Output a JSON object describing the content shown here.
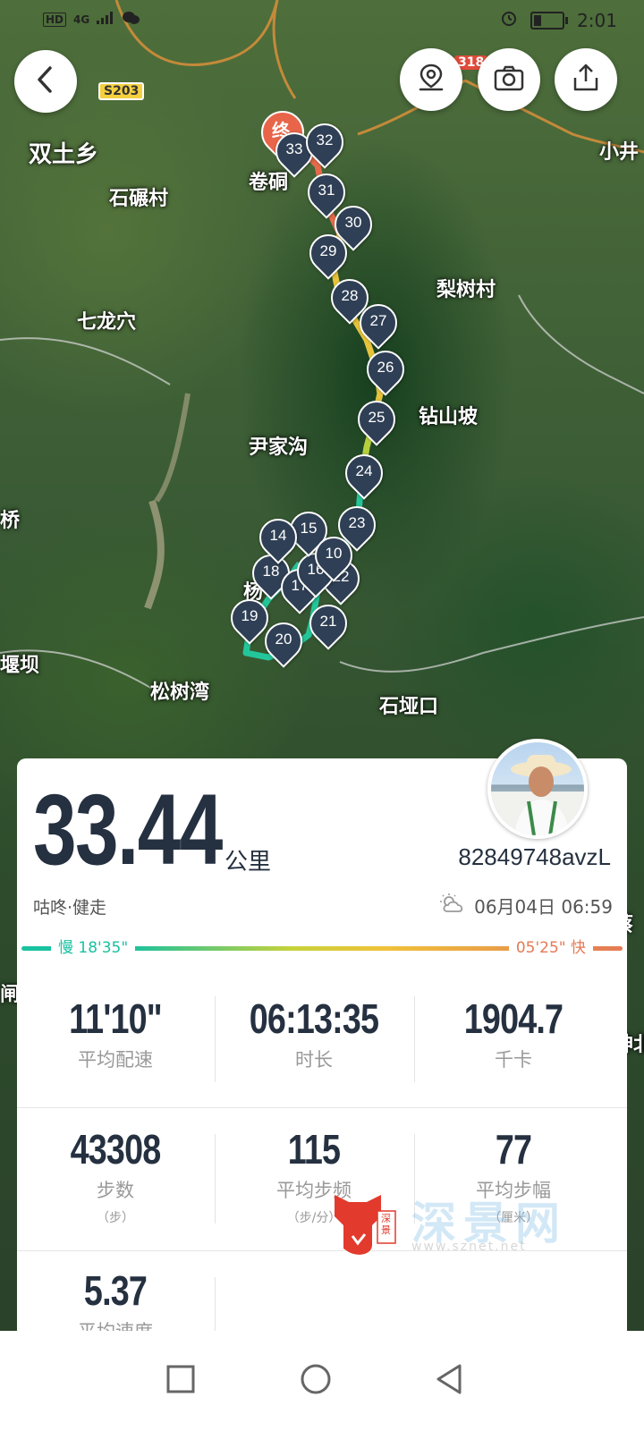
{
  "status_bar": {
    "network": "HD",
    "signal": "4G",
    "time": "2:01"
  },
  "map": {
    "road_badges": [
      "S203",
      "318"
    ],
    "end_marker": "终",
    "place_labels": [
      "双土乡",
      "石碾村",
      "卷硐",
      "小井",
      "七龙穴",
      "梨树村",
      "钻山坡",
      "尹家沟",
      "桥",
      "松树湾",
      "石垭口",
      "堰坝",
      "杨",
      "蔡",
      "闸家",
      "神北"
    ],
    "km_markers": [
      "33",
      "32",
      "31",
      "30",
      "29",
      "28",
      "27",
      "26",
      "25",
      "24",
      "23",
      "22",
      "21",
      "20",
      "19",
      "18",
      "17",
      "16",
      "15",
      "14",
      "10"
    ]
  },
  "toolbar": {
    "back_icon": "chevron-left-icon",
    "location_icon": "map-pin-icon",
    "camera_icon": "camera-icon",
    "share_icon": "share-icon"
  },
  "summary": {
    "distance": "33.44",
    "unit": "公里",
    "username": "82849748avzL",
    "activity": "咕咚·健走",
    "datetime": "06月04日 06:59",
    "weather_icon": "cloudy-sun-icon"
  },
  "pace_bar": {
    "slow_label": "慢 18'35\"",
    "fast_label": "05'25\" 快",
    "slow_color": "#19c2a0",
    "fast_color": "#e57a55"
  },
  "stats": [
    {
      "value": "11'10\"",
      "label": "平均配速",
      "sub": ""
    },
    {
      "value": "06:13:35",
      "label": "时长",
      "sub": ""
    },
    {
      "value": "1904.7",
      "label": "千卡",
      "sub": ""
    },
    {
      "value": "43308",
      "label": "步数",
      "sub": "（步）"
    },
    {
      "value": "115",
      "label": "平均步频",
      "sub": "（步/分）"
    },
    {
      "value": "77",
      "label": "平均步幅",
      "sub": "（厘米）"
    },
    {
      "value": "5.37",
      "label": "平均速度",
      "sub": ""
    }
  ],
  "watermark": {
    "text": "深景网",
    "seal": "深景",
    "url": "www.sznet.net"
  },
  "nav": {
    "recents_icon": "square-icon",
    "home_icon": "circle-icon",
    "back_icon": "triangle-back-icon"
  }
}
